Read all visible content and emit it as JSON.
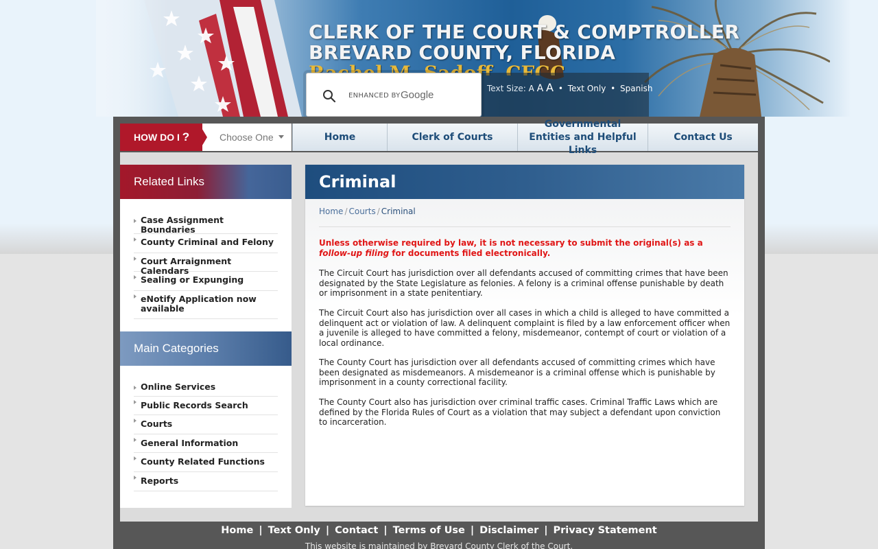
{
  "header": {
    "title_line1": "CLERK OF THE COURT & COMPTROLLER",
    "title_line2": "BREVARD COUNTY, FLORIDA",
    "title_line3": "Rachel M. Sadoff, CFCC",
    "search": {
      "enhanced_by": "ENHANCED BY",
      "brand": "Google"
    },
    "tools": {
      "text_size_label": "Text Size:",
      "size_small": "A",
      "size_medium": "A",
      "size_large": "A",
      "text_only": "Text Only",
      "spanish": "Spanish"
    }
  },
  "nav": {
    "how_do": "HOW DO I",
    "how_do_q": "?",
    "choose": "Choose One",
    "items": [
      "Home",
      "Clerk of Courts",
      "Governmental Entities and Helpful Links",
      "Contact Us"
    ]
  },
  "sidebar": {
    "related_title": "Related Links",
    "related_links": [
      "Case Assignment Boundaries",
      "County Criminal and Felony",
      "Court Arraignment Calendars",
      "Sealing or Expunging",
      "eNotify Application now available"
    ],
    "main_title": "Main Categories",
    "main_links": [
      "Online Services",
      "Public Records Search",
      "Courts",
      "General Information",
      "County Related Functions",
      "Reports"
    ]
  },
  "content": {
    "title": "Criminal",
    "breadcrumb": [
      "Home",
      "Courts",
      "Criminal"
    ],
    "notice_part1": "Unless otherwise required by law, it is not necessary to submit the original(s) as a ",
    "notice_italic": "follow-up filing",
    "notice_part2": " for documents filed electronically.",
    "paragraphs": [
      "The Circuit Court has jurisdiction over all defendants accused of committing crimes that have been designated by the State Legislature as felonies.  A felony is a criminal offense punishable by death or imprisonment in a state penitentiary.",
      "The Circuit Court also has jurisdiction over all cases in which a child is alleged to have committed a delinquent act or violation of law.  A delinquent complaint is filed by a law enforcement officer when a juvenile is alleged to have committed a felony, misdemeanor, contempt of court or violation of a local ordinance.",
      "The County Court has jurisdiction over all defendants accused of committing crimes which have been designated as misdemeanors.  A misdemeanor is a criminal offense which is punishable by imprisonment in a county correctional facility.",
      "The County Court also has jurisdiction over criminal traffic cases.  Criminal Traffic Laws which are defined by the Florida Rules of Court as a violation that may subject a defendant upon conviction to incarceration."
    ]
  },
  "footer": {
    "links": [
      "Home",
      "Text Only",
      "Contact",
      "Terms of Use",
      "Disclaimer",
      "Privacy Statement"
    ],
    "pipe": "|",
    "note": "This website is maintained by Brevard County Clerk of the Court."
  },
  "colors": {
    "brand_red": "#b0182a",
    "brand_blue": "#1e4d7e",
    "notice_red": "#e01616",
    "nav_text": "#1d4c78"
  }
}
